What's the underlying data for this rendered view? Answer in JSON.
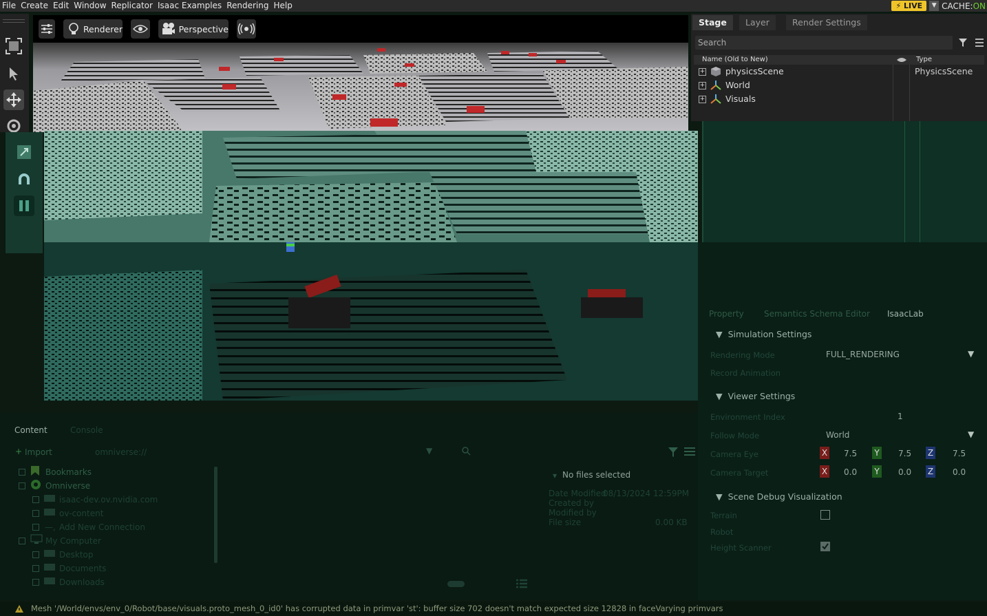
{
  "menubar": {
    "items": [
      "File",
      "Create",
      "Edit",
      "Window",
      "Replicator",
      "Isaac Examples",
      "Rendering",
      "Help"
    ],
    "live_label": "LIVE",
    "cache_label": "CACHE:",
    "cache_state": "ON"
  },
  "viewport": {
    "renderer_label": "Renderer",
    "camera_label": "Perspective"
  },
  "stage": {
    "tabs": [
      "Stage",
      "Layer",
      "Render Settings"
    ],
    "search_placeholder": "Search",
    "col_name": "Name (Old to New)",
    "col_type": "Type",
    "rows": [
      {
        "name": "physicsScene",
        "type": "PhysicsScene"
      },
      {
        "name": "World",
        "type": ""
      },
      {
        "name": "Visuals",
        "type": ""
      }
    ]
  },
  "property": {
    "tabs": [
      "Property",
      "Semantics Schema Editor",
      "IsaacLab"
    ],
    "sections": {
      "simulation": "Simulation Settings",
      "viewer": "Viewer Settings",
      "debug": "Scene Debug Visualization"
    },
    "rendering_mode_label": "Rendering Mode",
    "rendering_mode_value": "FULL_RENDERING",
    "record_animation_label": "Record Animation",
    "env_index_label": "Environment Index",
    "env_index_value": "1",
    "follow_mode_label": "Follow Mode",
    "follow_mode_value": "World",
    "camera_eye_label": "Camera Eye",
    "camera_eye": {
      "x": "7.5",
      "y": "7.5",
      "z": "7.5"
    },
    "camera_target_label": "Camera Target",
    "camera_target": {
      "x": "0.0",
      "y": "0.0",
      "z": "0.0"
    },
    "terrain_label": "Terrain",
    "robot_label": "Robot",
    "height_scanner_label": "Height Scanner",
    "terrain_checked": false,
    "height_scanner_checked": true
  },
  "content": {
    "tabs": [
      "Content",
      "Console"
    ],
    "import_label": "Import",
    "path_value": "omniverse://",
    "tree": [
      {
        "label": "Bookmarks"
      },
      {
        "label": "Omniverse"
      },
      {
        "label": "isaac-dev.ov.nvidia.com"
      },
      {
        "label": "ov-content"
      },
      {
        "label": "Add New Connection"
      },
      {
        "label": "My Computer"
      },
      {
        "label": "Desktop"
      },
      {
        "label": "Documents"
      },
      {
        "label": "Downloads"
      }
    ],
    "no_files": "No files selected",
    "date_modified_label": "Date Modified",
    "date_modified_value": "08/13/2024 12:59PM",
    "created_by_label": "Created by",
    "modified_by_label": "Modified by",
    "file_size_label": "File size",
    "file_size_value": "0.00 KB"
  },
  "status": {
    "message": "Mesh '/World/envs/env_0/Robot/base/visuals.proto_mesh_0_id0' has corrupted data in primvar 'st': buffer size 702 doesn't match expected size 12828 in faceVarying primvars"
  },
  "colors": {
    "accent_live": "#f0c52a",
    "cache_on": "#6ecf32",
    "x_axis": "#c0392b",
    "y_axis": "#2e8b2e",
    "z_axis": "#2c4f9e"
  }
}
